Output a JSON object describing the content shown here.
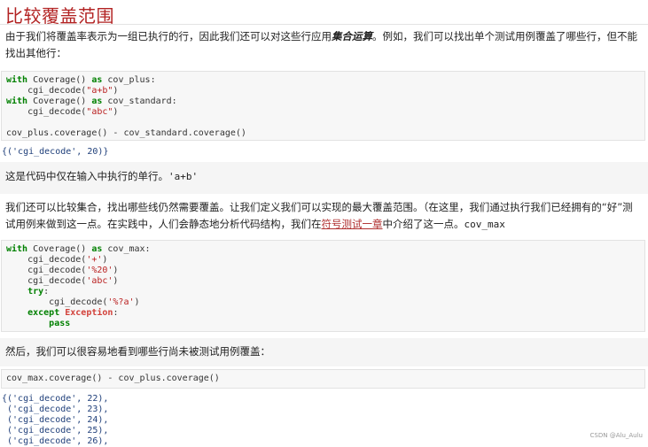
{
  "title": "比较覆盖范围",
  "para1": {
    "pre": "由于我们将覆盖率表示为一组已执行的行，因此我们还可以对这些行应用",
    "emph": "集合运算",
    "post": "。例如，我们可以找出单个测试用例覆盖了哪些行，但不能找出其他行："
  },
  "code1": {
    "kw_with": "with",
    "kw_as": "as",
    "line1_a": " Coverage() ",
    "line1_b": " cov_plus:",
    "line2_a": "    cgi_decode(",
    "line2_s": "\"a+b\"",
    "line2_b": ")",
    "line3_a": " Coverage() ",
    "line3_b": " cov_standard:",
    "line4_a": "    cgi_decode(",
    "line4_s": "\"abc\"",
    "line4_b": ")",
    "line6": "cov_plus.coverage() - cov_standard.coverage()"
  },
  "out1": "{('cgi_decode', 20)}",
  "para2": {
    "pre": "这是代码中仅在输入中执行的单行。",
    "code": "'a+b'"
  },
  "para3": {
    "pre": "我们还可以比较集合，找出哪些线仍然需要覆盖。让我们定义我们可以实现的最大覆盖范围。（在这里，我们通过执行我们已经拥有的“好”测试用例来做到这一点。在实践中，人们会静态地分析代码结构，我们在",
    "link": "符号测试一章",
    "post": "中介绍了这一点。",
    "code": "cov_max"
  },
  "code2": {
    "kw_with": "with",
    "kw_as": "as",
    "kw_try": "try",
    "kw_except": "except",
    "kw_pass": "pass",
    "exc": "Exception",
    "l1_a": " Coverage() ",
    "l1_b": " cov_max:",
    "l2_a": "    cgi_decode(",
    "l2_s": "'+'",
    "l2_b": ")",
    "l3_a": "    cgi_decode(",
    "l3_s": "'%20'",
    "l3_b": ")",
    "l4_a": "    cgi_decode(",
    "l4_s": "'abc'",
    "l4_b": ")",
    "l5_colon": ":",
    "l6_a": "        cgi_decode(",
    "l6_s": "'%?a'",
    "l6_b": ")",
    "l7_colon": ":"
  },
  "para4": "然后，我们可以很容易地看到哪些行尚未被测试用例覆盖：",
  "code3": "cov_max.coverage() - cov_plus.coverage()",
  "out2": [
    "{('cgi_decode', 22),",
    " ('cgi_decode', 23),",
    " ('cgi_decode', 24),",
    " ('cgi_decode', 25),",
    " ('cgi_decode', 26),"
  ],
  "watermark": "CSDN @Alu_Aulu"
}
